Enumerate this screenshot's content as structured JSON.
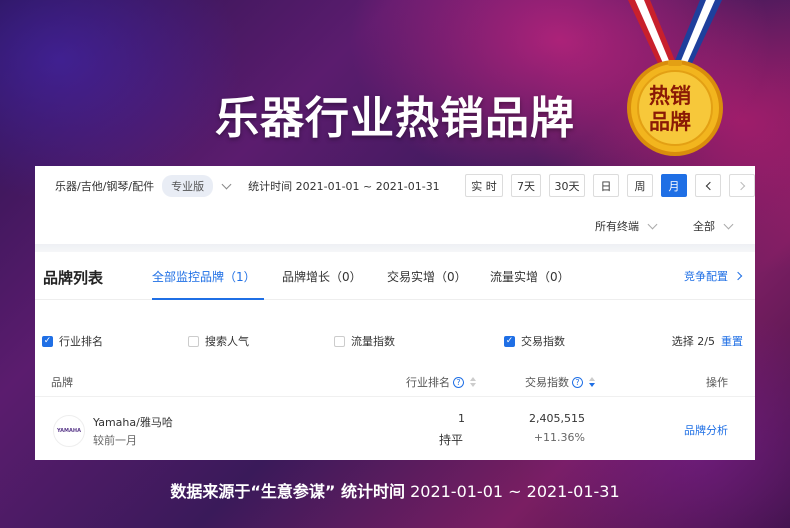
{
  "banner": {
    "title": "乐器行业热销品牌",
    "medal_line1": "热销",
    "medal_line2": "品牌",
    "footer_bold": "数据来源于“生意参谋” 统计时间",
    "footer_range": "2021-01-01 ~ 2021-01-31"
  },
  "toolbar": {
    "category": "乐器/吉他/钢琴/配件",
    "edition_badge": "专业版",
    "stat_time": "统计时间 2021-01-01 ~ 2021-01-31",
    "periods": [
      "实 时",
      "7天",
      "30天",
      "日",
      "周",
      "月"
    ],
    "active_period": "月"
  },
  "filters": {
    "terminal": "所有终端",
    "scope": "全部"
  },
  "tabs": {
    "heading": "品牌列表",
    "items": [
      "全部监控品牌（1）",
      "品牌增长（0）",
      "交易实增（0）",
      "流量实增（0）"
    ],
    "config_link": "竞争配置"
  },
  "metrics": {
    "options": [
      {
        "label": "行业排名",
        "checked": true
      },
      {
        "label": "搜索人气",
        "checked": false
      },
      {
        "label": "流量指数",
        "checked": false
      },
      {
        "label": "交易指数",
        "checked": true
      }
    ],
    "selected_text": "选择 2/5",
    "reset_label": "重置"
  },
  "table": {
    "headers": {
      "brand": "品牌",
      "rank": "行业排名",
      "trade": "交易指数",
      "action": "操作"
    },
    "rows": [
      {
        "logo": "YAMAHA",
        "brand": "Yamaha/雅马哈",
        "compare": "较前一月",
        "rank": "1",
        "rank_change": "持平",
        "trade": "2,405,515",
        "trade_change": "+11.36%",
        "action": "品牌分析"
      }
    ]
  },
  "colors": {
    "accent": "#1f6fe5",
    "gold": "#f2b51e"
  }
}
